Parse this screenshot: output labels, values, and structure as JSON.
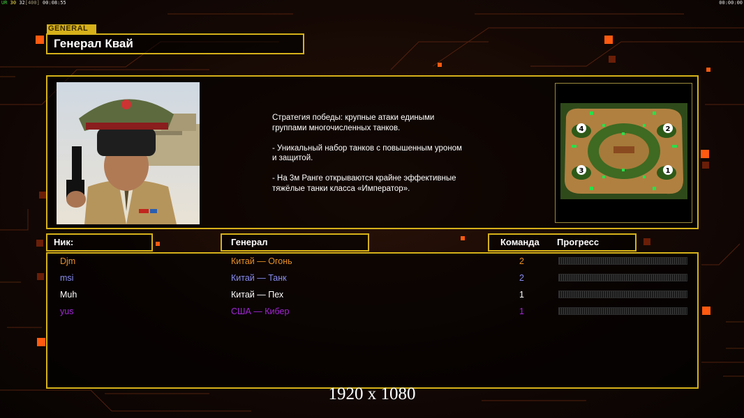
{
  "hud": {
    "fps_prefix": "UR",
    "fps_value": "30",
    "fps_target": "32",
    "bracket_value": "[400]",
    "elapsed": "00:08:55",
    "clock": "00:00:00"
  },
  "header": {
    "tag": "GENERAL",
    "title": "Генерал Квай"
  },
  "info": {
    "description": "Стратегия победы: крупные атаки едиными\n группами многочисленных танков.\n\n- Уникальный набор танков с повышенным уроном\n и защитой.\n\n- На 3м Ранге открываются крайне эффективные\n тяжёлые танки класса «Император».",
    "minimap_slots": [
      "4",
      "2",
      "3",
      "1"
    ]
  },
  "columns": {
    "nick": "Ник:",
    "general": "Генерал",
    "team": "Команда",
    "progress": "Прогресс"
  },
  "players": [
    {
      "nick": "Djm",
      "general": "Китай — Огонь",
      "team": "2",
      "color": "#e8902a",
      "progress": 0
    },
    {
      "nick": "msi",
      "general": "Китай — Танк",
      "team": "2",
      "color": "#8a8cf0",
      "progress": 0
    },
    {
      "nick": "Muh",
      "general": "Китай — Пех",
      "team": "1",
      "color": "#ffffff",
      "progress": 0
    },
    {
      "nick": "yus",
      "general": "США — Кибер",
      "team": "1",
      "color": "#a326d6",
      "progress": 0
    }
  ],
  "footer": {
    "resolution": "1920 x 1080"
  },
  "colors": {
    "frame": "#d6b11a",
    "accent_orange": "#ff5a10"
  }
}
